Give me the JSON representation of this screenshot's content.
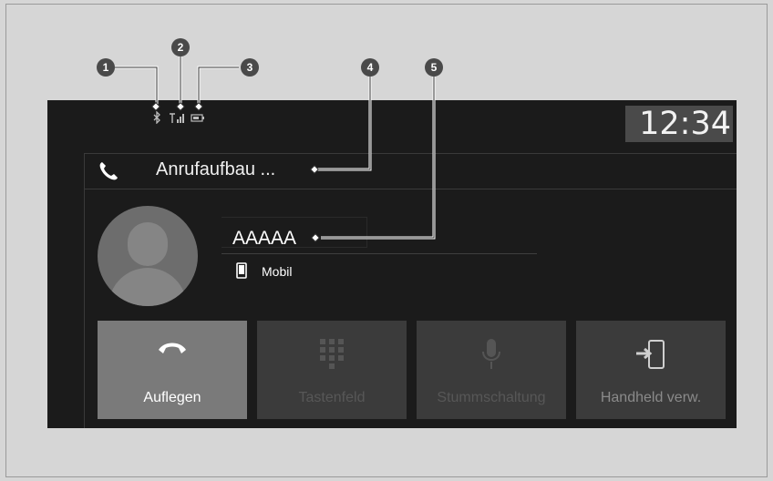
{
  "status": {
    "icons": [
      "bluetooth-icon",
      "signal-icon",
      "battery-icon"
    ],
    "clock": "12:34"
  },
  "call": {
    "status_text": "Anrufaufbau ...",
    "contact_name": "AAAAA",
    "number_type": "Mobil"
  },
  "actions": [
    {
      "label": "Auflegen",
      "icon": "hang-up-icon",
      "enabled": true
    },
    {
      "label": "Tastenfeld",
      "icon": "keypad-icon",
      "enabled": false
    },
    {
      "label": "Stummschaltung",
      "icon": "mute-icon",
      "enabled": false
    },
    {
      "label": "Handheld verw.",
      "icon": "handheld-transfer-icon",
      "enabled": false
    }
  ],
  "callouts": [
    "1",
    "2",
    "3",
    "4",
    "5"
  ],
  "colors": {
    "background": "#d6d6d6",
    "screen": "#1b1b1b",
    "active_button": "#7a7a7a",
    "inactive_button": "#3b3b3b",
    "callout": "#4a4a4a"
  }
}
